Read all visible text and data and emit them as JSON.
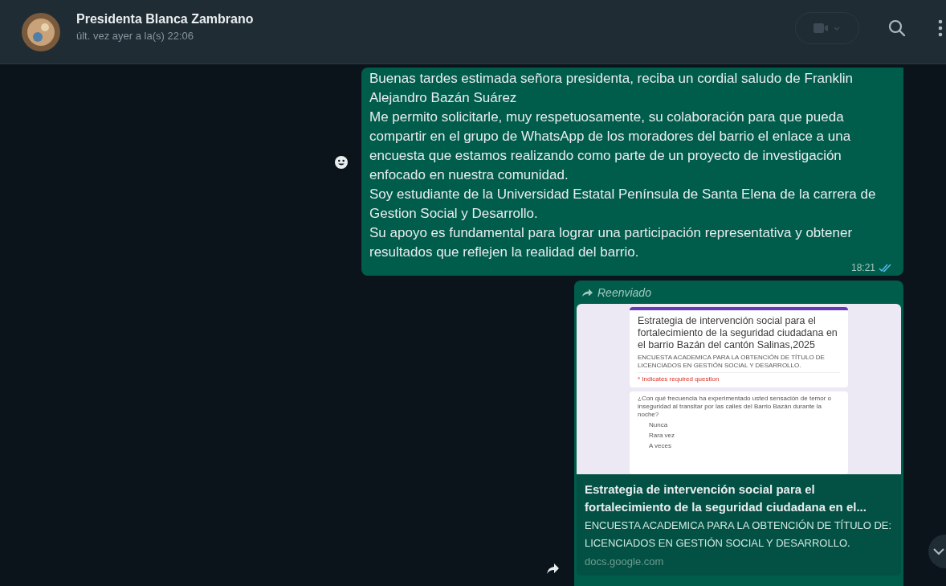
{
  "header": {
    "contact_name": "Presidenta Blanca Zambrano",
    "last_seen": "últ. vez ayer a la(s) 22:06"
  },
  "messages": [
    {
      "kind": "text",
      "lines": [
        "Buenas tardes estimada señora presidenta, reciba un cordial saludo de Franklin Alejandro Bazán Suárez",
        "Me permito solicitarle, muy respetuosamente, su colaboración para que pueda compartir en el grupo de WhatsApp de los moradores del barrio el enlace a una encuesta que estamos realizando como parte de un proyecto de investigación enfocado en nuestra comunidad.",
        "Soy estudiante de la Universidad Estatal Península de Santa Elena de la carrera de Gestion Social y Desarrollo.",
        "Su apoyo es fundamental para lograr una participación representativa y obtener resultados que reflejen la realidad del barrio."
      ],
      "time": "18:21",
      "read": true
    },
    {
      "kind": "link",
      "forwarded_label": "Reenviado",
      "preview": {
        "form_title": "Estrategia de intervención social para el fortalecimiento de la seguridad ciudadana en el barrio Bazán del cantón Salinas,2025",
        "form_subtitle": "ENCUESTA ACADEMICA PARA LA OBTENCIÓN DE TÍTULO DE LICENCIADOS EN GESTIÓN SOCIAL Y DESARROLLO.",
        "required_note": "* Indicates required question",
        "question": "¿Con qué frecuencia ha experimentado usted sensación de temor o inseguridad al transitar por las calles del Barrio Bazán durante la noche?",
        "options": [
          "Nunca",
          "Rara vez",
          "A veces"
        ]
      },
      "link_title": "Estrategia de intervención social para el fortalecimiento de la seguridad ciudadana en el...",
      "link_description": "ENCUESTA ACADEMICA PARA LA OBTENCIÓN DE TÍTULO DE: LICENCIADOS EN GESTIÓN SOCIAL Y DESARROLLO.",
      "link_domain": "docs.google.com"
    }
  ]
}
